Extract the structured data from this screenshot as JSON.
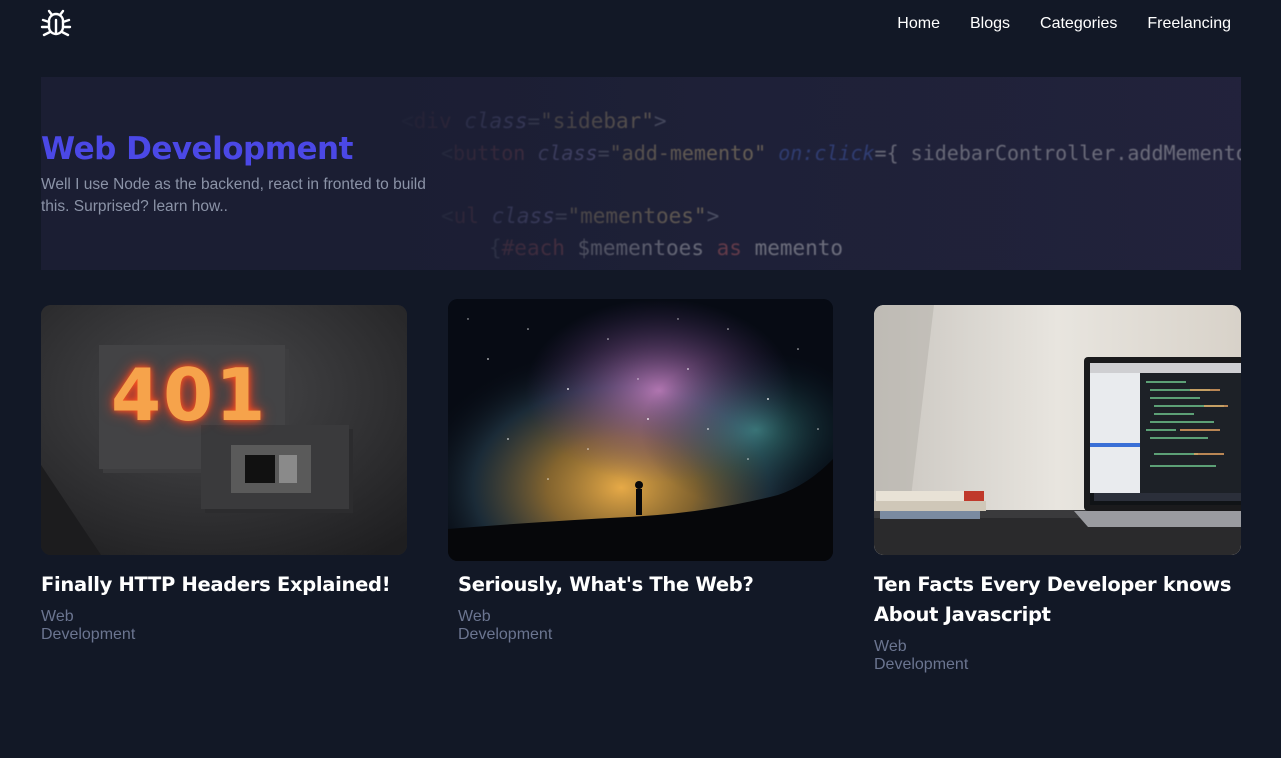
{
  "header": {
    "logo_icon": "bug-icon",
    "nav": [
      {
        "label": "Home"
      },
      {
        "label": "Blogs"
      },
      {
        "label": "Categories"
      },
      {
        "label": "Freelancing"
      }
    ]
  },
  "hero": {
    "title": "Web Development",
    "description": "Well I use Node as the backend, react in fronted to build this. Surprised? learn how..",
    "background_code": [
      "<div class=\"sidebar\">",
      "<button class=\"add-memento\" on:click={ sidebarController.addMemento (di this)}",
      "<ul class=\"mementoes\">",
      "{#each $mementoes as memento}"
    ],
    "title_color": "#4b48e6"
  },
  "posts": [
    {
      "title": "Finally HTTP Headers Explained!",
      "category": "Web Development",
      "image_label": "401",
      "image_kind": "401-sign-photo"
    },
    {
      "title": "Seriously, What's The Web?",
      "category": "Web Development",
      "image_kind": "milky-way-photo"
    },
    {
      "title": "Ten Facts Every Developer knows About Javascript",
      "category": "Web Development",
      "image_kind": "laptop-on-desk-photo"
    }
  ],
  "colors": {
    "background": "#121826",
    "accent": "#4b48e6",
    "muted_text": "#6b7590"
  }
}
